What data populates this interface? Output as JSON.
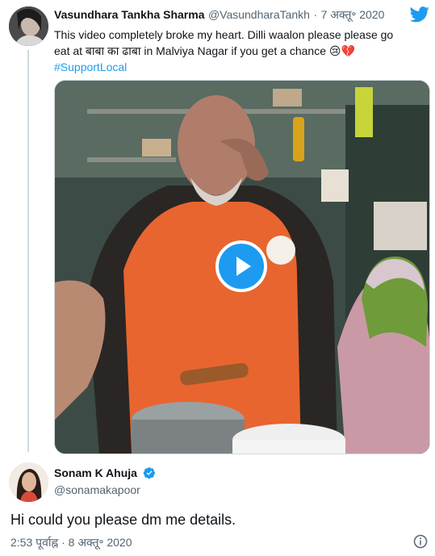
{
  "tweet": {
    "author_name": "Vasundhara Tankha Sharma",
    "author_handle": "@VasundharaTankh",
    "separator": "·",
    "date": "7 अक्तू॰ 2020",
    "text_line1": "This video completely broke my heart. Dilli waalon please please go",
    "text_line2": "eat at बाबा का ढाबा in Malviya Nagar if you get a chance 😢💔",
    "hashtag": "#SupportLocal",
    "media": {
      "type": "video",
      "has_play_button": true
    }
  },
  "reply": {
    "author_name": "Sonam K Ahuja",
    "verified": true,
    "author_handle": "@sonamakapoor",
    "text": "Hi could you please dm me details.",
    "timestamp": "2:53 पूर्वाह्न · 8 अक्तू॰ 2020"
  },
  "colors": {
    "accent": "#1d9bf0",
    "text": "#0f1419",
    "secondary": "#536471",
    "divider": "#cfd9de"
  },
  "icons": [
    "twitter-bird-icon",
    "play-icon",
    "verified-badge-icon",
    "info-icon"
  ]
}
